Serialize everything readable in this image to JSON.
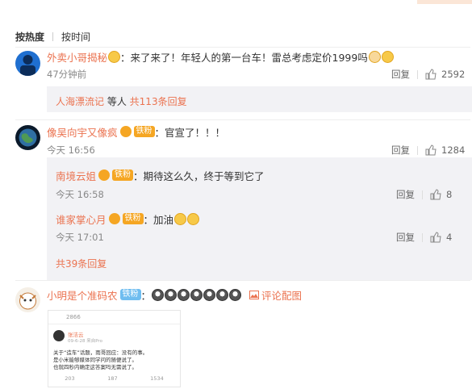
{
  "sort": {
    "hot": "按热度",
    "time": "按时间"
  },
  "comments": [
    {
      "user": "外卖小哥揭秘",
      "text": "：来了来了！年轻人的第一台车！雷总考虑定价1999吗",
      "time": "47分钟前",
      "reply": "回复",
      "likes": "2592",
      "summary_user": "人海漂流记",
      "summary_mid": " 等人 ",
      "summary_count": "共113条回复"
    },
    {
      "user": "像吴向宇又像疯",
      "badge": "铁粉",
      "text": "：官宣了！！！",
      "time": "今天 16:56",
      "reply": "回复",
      "likes": "1284",
      "replies": [
        {
          "user": "南境云姐",
          "badge": "铁粉",
          "text": "：期待这么久，终于等到它了",
          "time": "今天 16:58",
          "reply": "回复",
          "likes": "8"
        },
        {
          "user": "谁家掌心月",
          "badge": "铁粉",
          "text": "：加油",
          "time": "今天 17:01",
          "reply": "回复",
          "likes": "4"
        }
      ],
      "more": "共39条回复"
    },
    {
      "user": "小明是个准码农",
      "badge": "铁粉",
      "text": "：",
      "image_link": "评论配图",
      "image": {
        "top_stats": [
          "2866"
        ],
        "author": "张洁云",
        "meta": "09-6-28 来自Pro",
        "lines": [
          "关于“造车”话题，雨哥回应：没有的事。",
          "是小米能够媒体同学问的随便说了。",
          "也就四秒内确定这答案吗无需说了。"
        ],
        "stats": [
          "203",
          "187",
          "1534"
        ]
      }
    }
  ],
  "colors": {
    "name": "#eb7350",
    "meta": "#888888",
    "panel": "#f2f2f5"
  }
}
